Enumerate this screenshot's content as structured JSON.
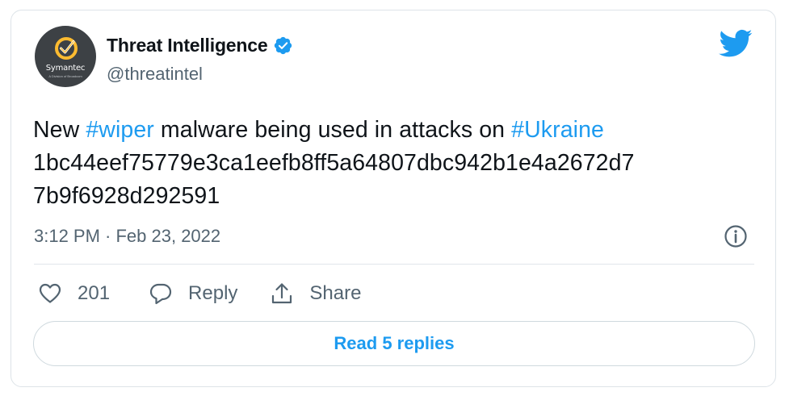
{
  "author": {
    "display_name": "Threat Intelligence",
    "handle": "@threatintel",
    "avatar_brand": "Symantec",
    "avatar_subtext": "A Division of Broadcom",
    "verified": true
  },
  "tweet": {
    "line1": {
      "pre": "New ",
      "tag1": "#wiper",
      "mid": " malware being used in attacks on ",
      "tag2": "#Ukraine"
    },
    "line2": "1bc44eef75779e3ca1eefb8ff5a64807dbc942b1e4a2672d7",
    "line3": "7b9f6928d292591"
  },
  "timestamp": "3:12 PM · Feb 23, 2022",
  "actions": {
    "like_count": "201",
    "reply_label": "Reply",
    "share_label": "Share"
  },
  "read_replies_label": "Read 5 replies",
  "icons": {
    "brand": "twitter-bird-icon",
    "verified": "verified-badge-icon",
    "info": "info-icon",
    "like": "heart-icon",
    "reply": "speech-bubble-icon",
    "share": "share-upload-icon"
  },
  "colors": {
    "accent": "#1d9bf0",
    "text": "#0f1419",
    "muted": "#536471",
    "avatar_bg": "#3d4145",
    "avatar_check": "#fdbb30"
  }
}
